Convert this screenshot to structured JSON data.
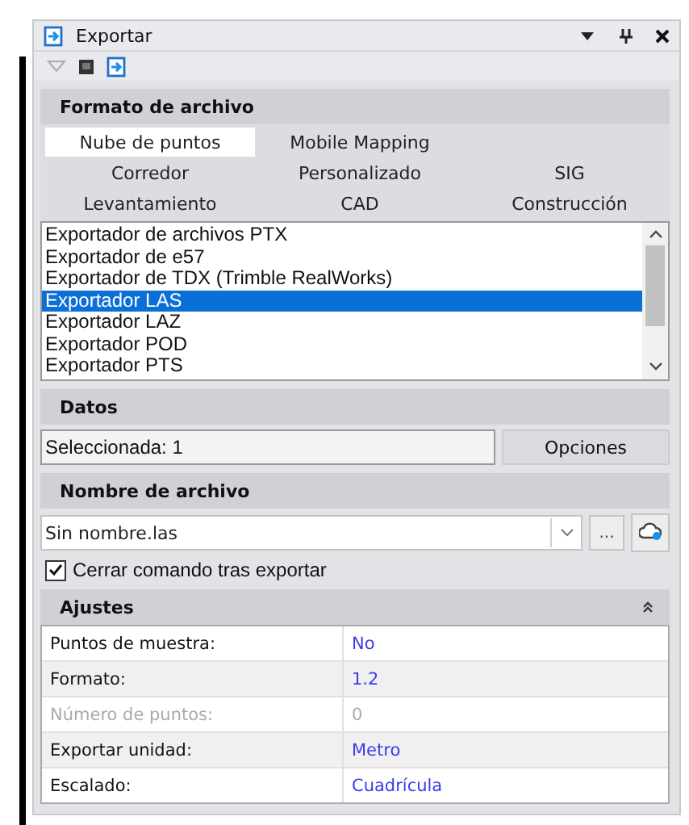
{
  "window": {
    "title": "Exportar"
  },
  "format": {
    "heading": "Formato de archivo",
    "tabs": [
      [
        {
          "label": "Nube de puntos",
          "selected": true
        },
        {
          "label": "Mobile Mapping",
          "selected": false
        }
      ],
      [
        {
          "label": "Corredor",
          "selected": false
        },
        {
          "label": "Personalizado",
          "selected": false
        },
        {
          "label": "SIG",
          "selected": false
        }
      ],
      [
        {
          "label": "Levantamiento",
          "selected": false
        },
        {
          "label": "CAD",
          "selected": false
        },
        {
          "label": "Construcción",
          "selected": false
        }
      ]
    ],
    "exporters": [
      {
        "label": "Exportador de archivos PTX",
        "selected": false
      },
      {
        "label": "Exportador de e57",
        "selected": false
      },
      {
        "label": "Exportador de TDX (Trimble RealWorks)",
        "selected": false
      },
      {
        "label": "Exportador LAS",
        "selected": true
      },
      {
        "label": "Exportador LAZ",
        "selected": false
      },
      {
        "label": "Exportador POD",
        "selected": false
      },
      {
        "label": "Exportador PTS",
        "selected": false
      }
    ]
  },
  "data": {
    "heading": "Datos",
    "selection": "Seleccionada: 1",
    "options_button": "Opciones"
  },
  "file": {
    "heading": "Nombre de archivo",
    "value": "Sin nombre.las",
    "browse_button": "...",
    "close_after": {
      "label": "Cerrar comando tras exportar",
      "checked": true
    }
  },
  "settings": {
    "heading": "Ajustes",
    "expanded": true,
    "rows": [
      {
        "label": "Puntos de muestra:",
        "value": "No",
        "disabled": false
      },
      {
        "label": "Formato:",
        "value": "1.2",
        "disabled": false
      },
      {
        "label": "Número de puntos:",
        "value": "0",
        "disabled": true
      },
      {
        "label": "Exportar unidad:",
        "value": "Metro",
        "disabled": false
      },
      {
        "label": "Escalado:",
        "value": "Cuadrícula",
        "disabled": false
      }
    ]
  }
}
